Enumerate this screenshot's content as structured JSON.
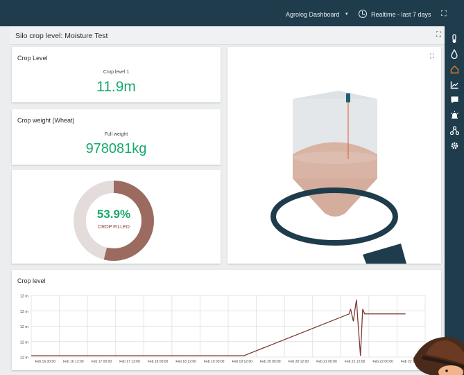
{
  "topbar": {
    "dashboard": "Agrolog Dashboard",
    "caret": "▾",
    "range": "Realtime - last 7 days",
    "fullscreen_icon": "fullscreen-icon"
  },
  "title": "Silo crop level: Moisture Test",
  "sidebar": {
    "items": [
      "thermometer-icon",
      "drop-icon",
      "home-icon",
      "chart-icon",
      "message-icon",
      "alarm-icon",
      "network-icon",
      "gear-icon"
    ],
    "active": "home-icon"
  },
  "crop_level": {
    "title": "Crop Level",
    "label": "Crop level 1",
    "value": "11.9m"
  },
  "crop_weight": {
    "title": "Crop weight (Wheat)",
    "label": "Full weight",
    "value": "978081kg"
  },
  "donut": {
    "percent_text": "53.9%",
    "label": "CROP FILLED",
    "fraction": 0.539,
    "fill_color": "#9b6b60",
    "track_color": "#e3dcdb"
  },
  "chart_panel": {
    "title": "Crop level"
  },
  "chart_data": {
    "type": "line",
    "title": "Crop level",
    "y_ticks": [
      "12 m",
      "12 m",
      "12 m",
      "12 m",
      "12 m"
    ],
    "x_ticks": [
      "Feb 16 00:00",
      "Feb 16 12:00",
      "Feb 17 00:00",
      "Feb 17 12:00",
      "Feb 18 00:00",
      "Feb 18 12:00",
      "Feb 19 00:00",
      "Feb 19 12:00",
      "Feb 20 00:00",
      "Feb 20 12:00",
      "Feb 21 00:00",
      "Feb 21 12:00",
      "Feb 22 00:00",
      "Feb 22 12:00"
    ],
    "series": [
      {
        "color": "#7a3a32",
        "points": [
          [
            0,
            0.02
          ],
          [
            7.55,
            0.02
          ],
          [
            11.3,
            0.7
          ],
          [
            11.35,
            0.78
          ],
          [
            11.45,
            0.58
          ],
          [
            11.52,
            0.82
          ],
          [
            11.56,
            0.93
          ],
          [
            11.6,
            0.65
          ],
          [
            11.7,
            0.02
          ],
          [
            11.78,
            0.78
          ],
          [
            11.85,
            0.7
          ],
          [
            13.3,
            0.7
          ]
        ]
      }
    ],
    "grid": true,
    "legend": "none"
  },
  "colors": {
    "primary": "#1f3c4d",
    "accent": "#e07c2a",
    "value_green": "#17a96b",
    "silo_fill": "#d9b3a3",
    "silo_glass": "#e3e7ea",
    "ring": "#1f3c4d"
  }
}
